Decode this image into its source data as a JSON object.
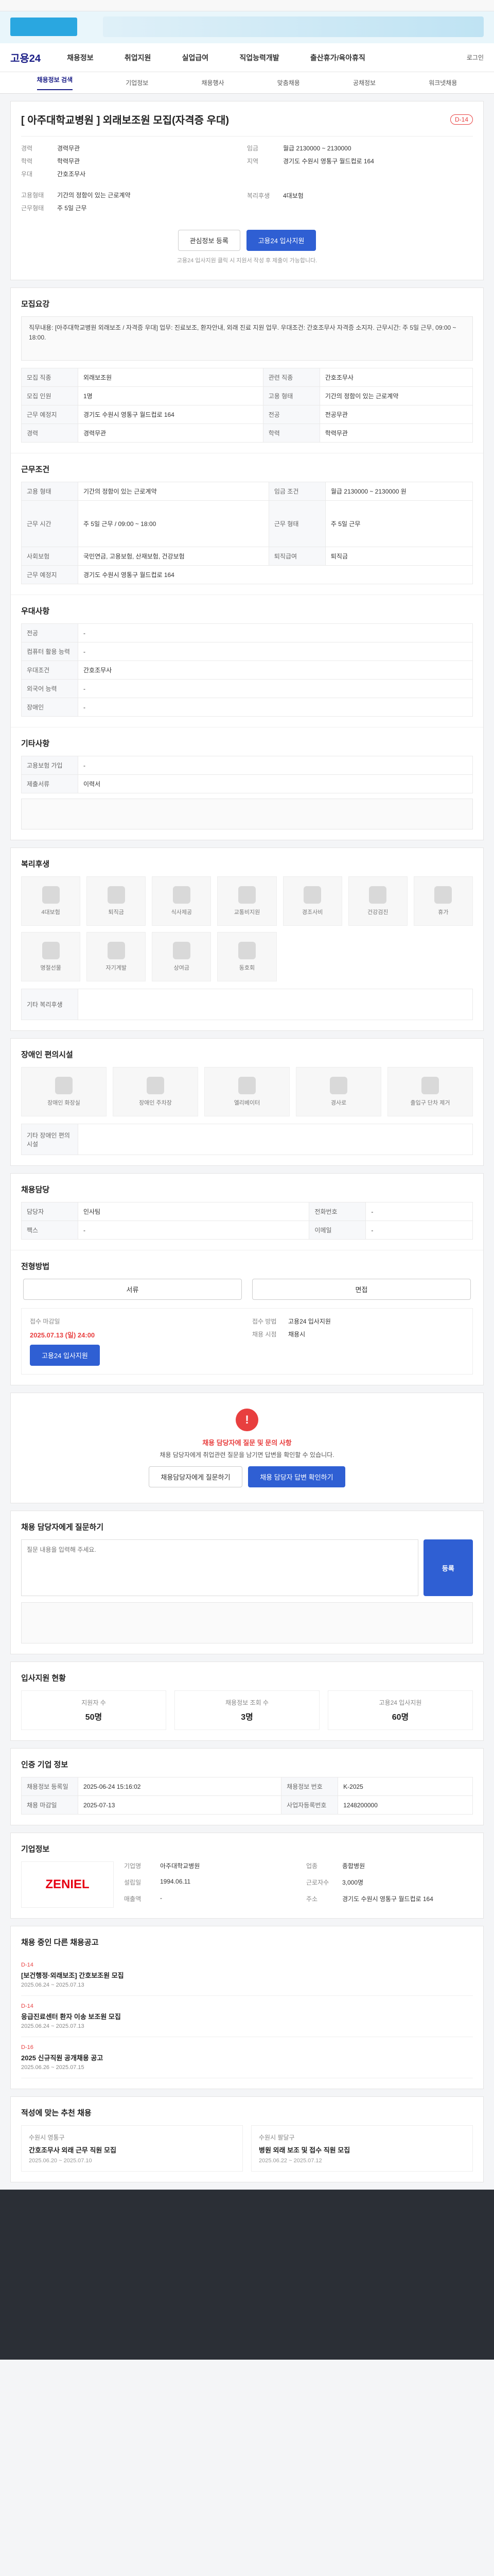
{
  "site": {
    "brand": "고용24",
    "menus": [
      "채용정보",
      "취업지원",
      "실업급여",
      "직업능력개발",
      "출산휴가/육아휴직"
    ],
    "util": "로그인"
  },
  "subnav": [
    "채용정보 검색",
    "기업정보",
    "채용행사",
    "맞춤채용",
    "공채정보",
    "워크넷채용"
  ],
  "job": {
    "title": "[ 아주대학교병원 ] 외래보조원 모집(자격증 우대)",
    "dday": "D-14",
    "left": [
      {
        "k": "경력",
        "v": "경력무관"
      },
      {
        "k": "학력",
        "v": "학력무관"
      },
      {
        "k": "우대",
        "v": "간호조무사"
      }
    ],
    "right": [
      {
        "k": "임금",
        "v": "월급 2130000 ~ 2130000"
      },
      {
        "k": "지역",
        "v": "경기도 수원시 영통구 월드컵로 164"
      }
    ],
    "left2": [
      {
        "k": "고용형태",
        "v": "기간의 정함이 있는 근로계약"
      },
      {
        "k": "근무형태",
        "v": "주 5일 근무"
      }
    ],
    "right2": [
      {
        "k": "복리후생",
        "v": "4대보험"
      }
    ],
    "btn_scrap": "관심정보 등록",
    "btn_apply": "고용24 입사지원",
    "apply_note": "고용24 입사지원 클릭 시 지원서 작성 후 제출이 가능합니다."
  },
  "sections": {
    "recruit_title": "모집요강",
    "recruit_box": "직무내용: [아주대학교병원 외래보조 / 자격증 우대] 업무: 진료보조, 환자안내, 외래 진료 지원 업무. 우대조건: 간호조무사 자격증 소지자. 근무시간: 주 5일 근무, 09:00 ~ 18:00.",
    "recruit_rows": [
      {
        "k1": "모집 직종",
        "v1": "외래보조원",
        "k2": "관련 직종",
        "v2": "간호조무사"
      },
      {
        "k1": "모집 인원",
        "v1": "1명",
        "k2": "고용 형태",
        "v2": "기간의 정함이 있는 근로계약"
      },
      {
        "k1": "근무 예정지",
        "v1": "경기도 수원시 영통구 월드컵로 164",
        "k2": "전공",
        "v2": "전공무관"
      },
      {
        "k1": "경력",
        "v1": "경력무관",
        "k2": "학력",
        "v2": "학력무관"
      }
    ],
    "work_title": "근무조건",
    "work_rows": [
      {
        "k1": "고용 형태",
        "v1": "기간의 정함이 있는 근로계약",
        "k2": "임금 조건",
        "v2": "월급 2130000 ~ 2130000 원"
      },
      {
        "k1": "근무 시간",
        "v1": "주 5일 근무 / 09:00 ~ 18:00",
        "k2": "근무 형태",
        "v2": "주 5일 근무"
      },
      {
        "k1": "사회보험",
        "v1": "국민연금, 고용보험, 산재보험, 건강보험",
        "k2": "퇴직급여",
        "v2": "퇴직금"
      },
      {
        "k1": "근무 예정지",
        "v1": "경기도 수원시 영통구 월드컵로 164",
        "k2": "",
        "v2": ""
      }
    ],
    "etc_title": "우대사항",
    "etc_rows": [
      {
        "k": "전공",
        "v": "-"
      },
      {
        "k": "컴퓨터 활용 능력",
        "v": "-"
      },
      {
        "k": "우대조건",
        "v": "간호조무사"
      },
      {
        "k": "외국어 능력",
        "v": "-"
      },
      {
        "k": "장애인",
        "v": "-"
      }
    ],
    "career_title": "기타사항",
    "career_rows": [
      {
        "k": "고용보험 가입",
        "v": "-"
      },
      {
        "k": "제출서류",
        "v": "이력서"
      }
    ],
    "benefit_title": "복리후생",
    "benefits": [
      "4대보험",
      "퇴직금",
      "식사제공",
      "교통비지원",
      "경조사비",
      "건강검진",
      "휴가",
      "명절선물",
      "자기계발",
      "상여금",
      "동호회"
    ],
    "benefit_extra": "기타 복리후생",
    "disability_title": "장애인 편의시설",
    "disability_items": [
      "장애인 화장실",
      "장애인 주차장",
      "엘리베이터",
      "경사로",
      "출입구 단차 제거"
    ],
    "disability_extra": "기타 장애인 편의시설",
    "office_title": "채용담당",
    "office_rows": [
      {
        "k1": "담당자",
        "v1": "인사팀",
        "k2": "전화번호",
        "v2": "-"
      },
      {
        "k1": "팩스",
        "v1": "-",
        "k2": "이메일",
        "v2": "-"
      }
    ],
    "process_title": "전형방법",
    "process_tabs": [
      "서류",
      "면접"
    ],
    "deadline_label": "접수 마감일",
    "deadline_value": "2025.07.13 (일) 24:00",
    "method_label": "접수 방법",
    "method_value": "고용24 입사지원",
    "apply_btn": "고용24 입사지원",
    "result_label": "채용 시점",
    "result_value": "채용시",
    "alert_title": "채용 담당자에 질문 및 문의 사항",
    "alert_desc": "채용 담당자에게 취업관련 질문을 남기면 답변을 확인할 수 있습니다.",
    "alert_btn1": "채용담당자에게 질문하기",
    "alert_btn2": "채용 담당자 답변 확인하기",
    "qa_label": "채용 담당자에게 질문하기",
    "qa_placeholder": "질문 내용을 입력해 주세요.",
    "qa_submit": "등록",
    "stats_title": "입사지원 현황",
    "stats": [
      {
        "k": "지원자 수",
        "v": "50명"
      },
      {
        "k": "채용정보 조회 수",
        "v": "3명"
      },
      {
        "k": "고용24 입사지원",
        "v": "60명"
      }
    ],
    "info_title": "인증 기업 정보",
    "info_rows": [
      {
        "k1": "채용정보 등록일",
        "v1": "2025-06-24 15:16:02",
        "k2": "채용정보 번호",
        "v2": "K-2025"
      },
      {
        "k1": "채용 마감일",
        "v1": "2025-07-13",
        "k2": "사업자등록번호",
        "v2": "1248200000"
      }
    ],
    "company_title": "기업정보",
    "company_logo": "ZENIEL",
    "company_rows": [
      {
        "k": "기업명",
        "v": "아주대학교병원"
      },
      {
        "k": "업종",
        "v": "종합병원"
      },
      {
        "k": "설립일",
        "v": "1994.06.11"
      },
      {
        "k": "근로자수",
        "v": "3,000명"
      },
      {
        "k": "매출액",
        "v": "-"
      },
      {
        "k": "주소",
        "v": "경기도 수원시 영통구 월드컵로 164"
      }
    ],
    "related_title": "채용 중인 다른 채용공고",
    "related": [
      {
        "tag": "D-14",
        "t": "[보건행정·외래보조] 간호보조원 모집",
        "d": "2025.06.24 ~ 2025.07.13"
      },
      {
        "tag": "D-14",
        "t": "응급진료센터 환자 이송 보조원 모집",
        "d": "2025.06.24 ~ 2025.07.13"
      },
      {
        "tag": "D-16",
        "t": "2025 신규직원 공개채용 공고",
        "d": "2025.06.26 ~ 2025.07.15"
      }
    ],
    "rec_title": "적성에 맞는 추천 채용",
    "recs": [
      {
        "c": "수원시 영통구",
        "t": "간호조무사 외래 근무 직원 모집",
        "d": "2025.06.20 ~ 2025.07.10"
      },
      {
        "c": "수원시 팔달구",
        "t": "병원 외래 보조 및 접수 직원 모집",
        "d": "2025.06.22 ~ 2025.07.12"
      }
    ]
  }
}
